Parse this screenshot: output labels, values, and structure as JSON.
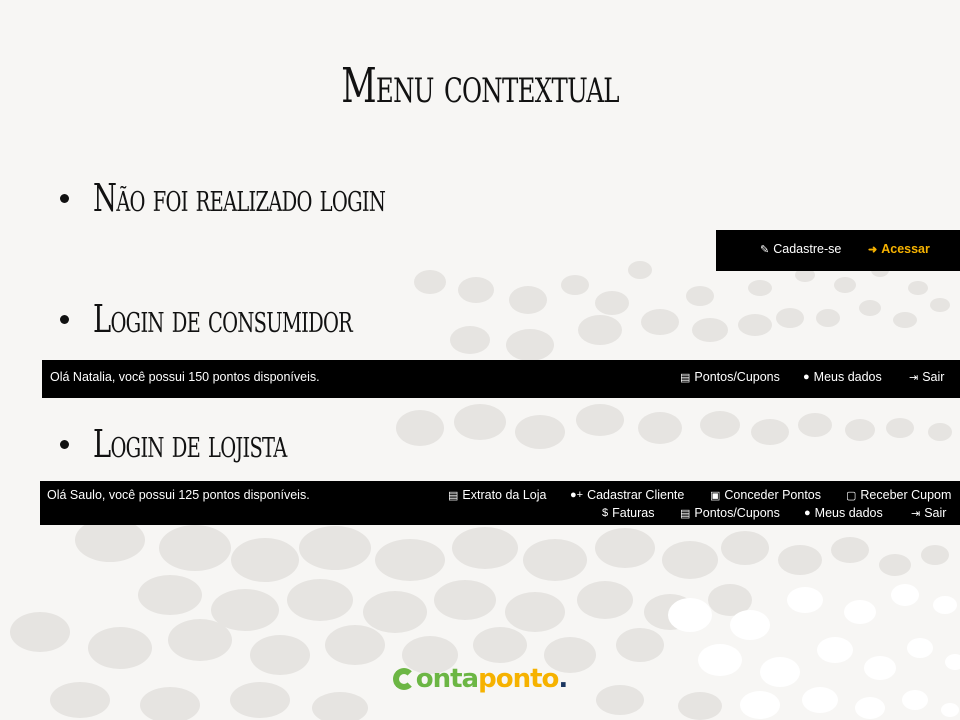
{
  "slide": {
    "title": "Menu contextual",
    "bullets": [
      "Não foi realizado login",
      "Login de consumidor",
      "Login de lojista"
    ]
  },
  "guest_bar": {
    "items": [
      {
        "icon": "edit-icon",
        "label": "Cadastre-se"
      },
      {
        "icon": "sign-in-icon",
        "label": "Acessar"
      }
    ]
  },
  "consumer_bar": {
    "greeting": "Olá Natalia, você possui 150 pontos disponíveis.",
    "items": [
      {
        "icon": "file-icon",
        "label": "Pontos/Cupons"
      },
      {
        "icon": "user-icon",
        "label": "Meus dados"
      },
      {
        "icon": "sign-out-icon",
        "label": "Sair"
      }
    ]
  },
  "merchant_bar": {
    "greeting": "Olá Saulo, você possui 125 pontos disponíveis.",
    "items": [
      {
        "icon": "file-icon",
        "label": "Extrato da Loja"
      },
      {
        "icon": "add-user-icon",
        "label": "Cadastrar Cliente"
      },
      {
        "icon": "money-icon",
        "label": "Conceder Pontos"
      },
      {
        "icon": "ticket-icon",
        "label": "Receber Cupom"
      },
      {
        "icon": "dollar-icon",
        "label": "Faturas"
      },
      {
        "icon": "file-icon",
        "label": "Pontos/Cupons"
      },
      {
        "icon": "user-icon",
        "label": "Meus dados"
      },
      {
        "icon": "sign-out-icon",
        "label": "Sair"
      }
    ]
  },
  "logo": {
    "part1": "onta",
    "part2": "ponto",
    "part3": "."
  },
  "colors": {
    "accent": "#f6b200",
    "logo_green": "#6cb644",
    "logo_navy": "#1b3660",
    "bar_bg": "#000000"
  }
}
